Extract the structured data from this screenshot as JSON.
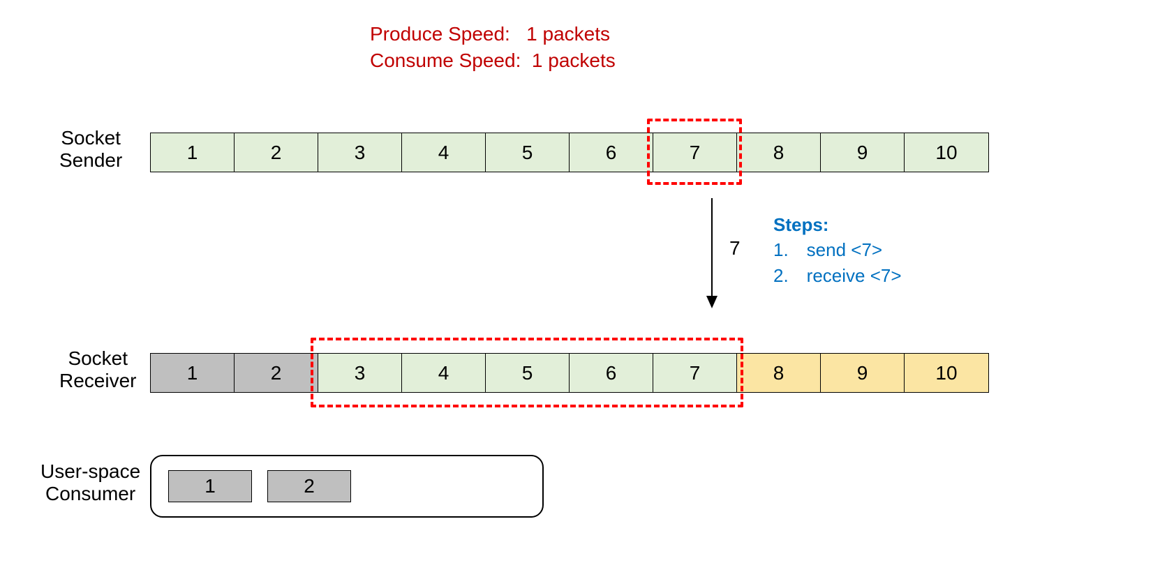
{
  "speeds": {
    "produce_label": "Produce Speed:",
    "produce_value": "1 packets",
    "consume_label": "Consume Speed:",
    "consume_value": "1 packets"
  },
  "labels": {
    "sender_l1": "Socket",
    "sender_l2": "Sender",
    "receiver_l1": "Socket",
    "receiver_l2": "Receiver",
    "user_l1": "User-space",
    "user_l2": "Consumer"
  },
  "sender": {
    "cells": [
      "1",
      "2",
      "3",
      "4",
      "5",
      "6",
      "7",
      "8",
      "9",
      "10"
    ],
    "colors": [
      "green",
      "green",
      "green",
      "green",
      "green",
      "green",
      "green",
      "green",
      "green",
      "green"
    ],
    "highlight_index": 6
  },
  "receiver": {
    "cells": [
      "1",
      "2",
      "3",
      "4",
      "5",
      "6",
      "7",
      "8",
      "9",
      "10"
    ],
    "colors": [
      "grey",
      "grey",
      "green",
      "green",
      "green",
      "green",
      "green",
      "cream",
      "cream",
      "cream"
    ],
    "window_start": 2,
    "window_end": 6
  },
  "arrow": {
    "value": "7"
  },
  "steps": {
    "title": "Steps:",
    "items": [
      "send <7>",
      "receive <7>"
    ]
  },
  "consumer": {
    "items": [
      "1",
      "2"
    ]
  }
}
